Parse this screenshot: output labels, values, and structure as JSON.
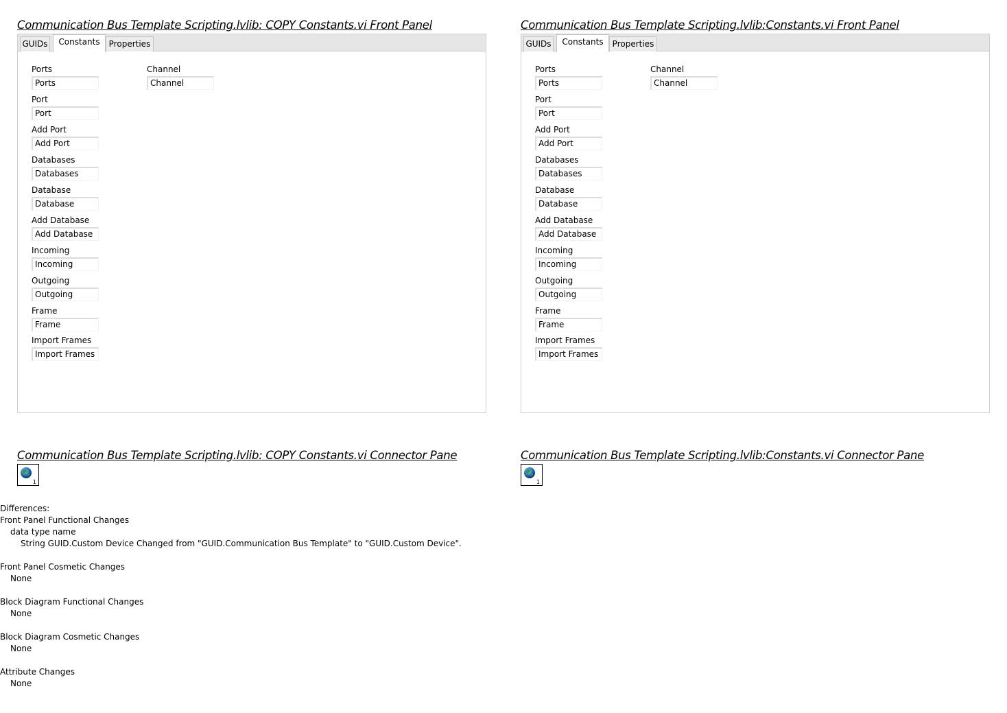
{
  "left_panel": {
    "title": "Communication Bus Template Scripting.lvlib:  COPY  Constants.vi Front Panel",
    "tabs": [
      "GUIDs",
      "Constants",
      "Properties"
    ],
    "active_tab": "Constants",
    "controls_col1": [
      {
        "label": "Ports",
        "value": "Ports"
      },
      {
        "label": "Port",
        "value": "Port"
      },
      {
        "label": "Add Port",
        "value": "Add Port"
      },
      {
        "label": "Databases",
        "value": "Databases"
      },
      {
        "label": "Database",
        "value": "Database"
      },
      {
        "label": "Add Database",
        "value": "Add Database"
      },
      {
        "label": "Incoming",
        "value": "Incoming"
      },
      {
        "label": "Outgoing",
        "value": "Outgoing"
      },
      {
        "label": "Frame",
        "value": "Frame"
      },
      {
        "label": "Import Frames",
        "value": "Import Frames"
      }
    ],
    "controls_col2": [
      {
        "label": "Channel",
        "value": "Channel"
      }
    ]
  },
  "right_panel": {
    "title": "Communication Bus Template Scripting.lvlib:Constants.vi Front Panel",
    "tabs": [
      "GUIDs",
      "Constants",
      "Properties"
    ],
    "active_tab": "Constants",
    "controls_col1": [
      {
        "label": "Ports",
        "value": "Ports"
      },
      {
        "label": "Port",
        "value": "Port"
      },
      {
        "label": "Add Port",
        "value": "Add Port"
      },
      {
        "label": "Databases",
        "value": "Databases"
      },
      {
        "label": "Database",
        "value": "Database"
      },
      {
        "label": "Add Database",
        "value": "Add Database"
      },
      {
        "label": "Incoming",
        "value": "Incoming"
      },
      {
        "label": "Outgoing",
        "value": "Outgoing"
      },
      {
        "label": "Frame",
        "value": "Frame"
      },
      {
        "label": "Import Frames",
        "value": "Import Frames"
      }
    ],
    "controls_col2": [
      {
        "label": "Channel",
        "value": "Channel"
      }
    ]
  },
  "left_connector": {
    "title": "Communication Bus Template Scripting.lvlib:  COPY  Constants.vi Connector Pane",
    "terminal_number": "1",
    "icon": "globe-icon"
  },
  "right_connector": {
    "title": "Communication Bus Template Scripting.lvlib:Constants.vi Connector Pane",
    "terminal_number": "1",
    "icon": "globe-icon"
  },
  "differences": {
    "heading": "Differences:",
    "fp_functional": {
      "heading": "Front Panel Functional Changes",
      "sub": "data type name",
      "detail": "String GUID.Custom Device Changed from \"GUID.Communication Bus Template\" to \"GUID.Custom Device\"."
    },
    "fp_cosmetic": {
      "heading": "Front Panel Cosmetic Changes",
      "value": "None"
    },
    "bd_functional": {
      "heading": "Block Diagram Functional Changes",
      "value": "None"
    },
    "bd_cosmetic": {
      "heading": "Block Diagram Cosmetic Changes",
      "value": "None"
    },
    "attributes": {
      "heading": "Attribute Changes",
      "value": "None"
    }
  }
}
